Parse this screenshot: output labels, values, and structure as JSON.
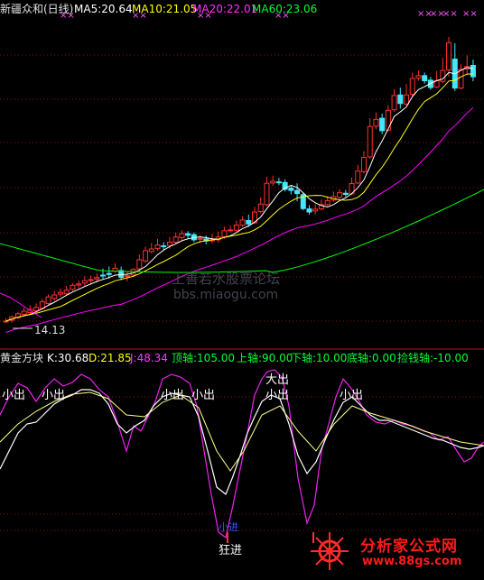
{
  "price_panel": {
    "name": "新疆众和(日线)",
    "ma5": "MA5:20.64",
    "ma10": "MA10:21.05",
    "ma20": "MA20:22.01",
    "ma60": "MA60:23.06",
    "low_marker": "14.13",
    "colors": {
      "ma5": "#ffffff",
      "ma10": "#ffff00",
      "ma20": "#ff00ff",
      "ma60": "#00ff00"
    }
  },
  "indicator_panel": {
    "name": "黄金方块",
    "k": "K:30.68",
    "d": "D:21.85",
    "j": "J:48.34",
    "top_axis": "顶轴:105.00",
    "upper_axis": "上轴:90.00",
    "lower_axis": "下轴:10.00",
    "bottom_axis": "底轴:0.00",
    "pickup_axis": "捡钱轴:-10.00"
  },
  "signals": {
    "small_out": "小出",
    "big_out": "大出",
    "crazy_in": "狂进",
    "small_in": "小进"
  },
  "watermark": {
    "line1": "上善若水股票论坛",
    "line2": "bbs.miaogu.com"
  },
  "logo": {
    "title": "分析家公式网",
    "url": "www.88gs.com"
  },
  "chart_data": {
    "type": "candlestick",
    "series": [
      {
        "name": "MA5",
        "values": [
          20.64
        ]
      },
      {
        "name": "MA10",
        "values": [
          21.05
        ]
      },
      {
        "name": "MA20",
        "values": [
          22.01
        ]
      },
      {
        "name": "MA60",
        "values": [
          23.06
        ]
      },
      {
        "name": "K",
        "values": [
          30.68
        ]
      },
      {
        "name": "D",
        "values": [
          21.85
        ]
      },
      {
        "name": "J",
        "values": [
          48.34
        ]
      }
    ],
    "axis_levels": {
      "top": 105,
      "upper": 90,
      "lower": 10,
      "bottom": 0,
      "pickup": -10
    },
    "low_price": 14.13,
    "candles_price_shape": [
      [
        0,
        0,
        0,
        1
      ],
      [
        0.3,
        1.5,
        -0.5,
        2
      ],
      [
        1.2,
        2.6,
        0.8,
        3.2
      ],
      [
        2.4,
        3.5,
        1.6,
        4.8
      ],
      [
        3,
        4.1,
        2.4,
        5.6
      ],
      [
        3.6,
        4.8,
        2.8,
        6.2
      ],
      [
        4.5,
        6.8,
        4,
        7.8
      ],
      [
        6.2,
        8.5,
        5.8,
        9.4
      ],
      [
        8,
        9.2,
        7.2,
        10.6
      ],
      [
        9.5,
        10.1,
        8.6,
        11.5
      ],
      [
        9.6,
        10.9,
        9.2,
        12.4
      ],
      [
        11.2,
        12.6,
        10.6,
        13.4
      ],
      [
        12.7,
        13.1,
        11.5,
        14.4
      ],
      [
        13.4,
        14.2,
        12.4,
        15.8
      ],
      [
        14.5,
        14.6,
        12.8,
        16
      ],
      [
        14.8,
        15.3,
        13.6,
        16.8
      ],
      [
        16.2,
        16.1,
        14.6,
        18.5
      ],
      [
        16.8,
        16.4,
        14.9,
        19.2
      ],
      [
        17.6,
        18.6,
        17,
        20.4
      ],
      [
        17.8,
        15.4,
        14.4,
        19.2
      ],
      [
        15.8,
        16,
        14,
        17.4
      ],
      [
        16.2,
        18.2,
        15.8,
        18.6
      ],
      [
        18.4,
        21.6,
        17.5,
        23.4
      ],
      [
        21.2,
        24.8,
        20.5,
        26.2
      ],
      [
        24.5,
        25.4,
        23.8,
        27.5
      ],
      [
        25.6,
        26.8,
        24.8,
        28.9
      ],
      [
        26.5,
        26.4,
        25,
        27.8
      ],
      [
        26.6,
        27.8,
        25.5,
        29.6
      ],
      [
        27.8,
        29.6,
        27.2,
        31.2
      ],
      [
        29.4,
        30.8,
        28.6,
        32
      ],
      [
        30.8,
        30.2,
        28.8,
        31.7
      ],
      [
        30.4,
        28.6,
        27.8,
        31.2
      ],
      [
        28.8,
        29.1,
        27.5,
        30.2
      ],
      [
        28.9,
        28.2,
        27,
        30.1
      ],
      [
        28.4,
        28.6,
        27.4,
        30.8
      ],
      [
        28.6,
        29.6,
        27.6,
        31.5
      ],
      [
        29.7,
        31.8,
        29,
        33.2
      ],
      [
        31.9,
        32.1,
        31.2,
        33.5
      ],
      [
        32,
        33.8,
        31.5,
        35.4
      ],
      [
        33.8,
        35.6,
        33.2,
        36.8
      ],
      [
        35.4,
        34.2,
        33.2,
        37.5
      ],
      [
        34.6,
        38.4,
        34.2,
        40.2
      ],
      [
        38.6,
        41.2,
        38,
        43.6
      ],
      [
        41,
        48.5,
        40.4,
        50.8
      ],
      [
        48.6,
        49.2,
        47.6,
        51.2
      ],
      [
        49,
        48.8,
        47.8,
        50.4
      ],
      [
        48.8,
        46.4,
        45.6,
        49.9
      ],
      [
        46.8,
        46,
        44.6,
        47.6
      ],
      [
        46,
        44.9,
        42.2,
        48.5
      ],
      [
        44.5,
        39.6,
        39,
        45.2
      ],
      [
        39.5,
        38.4,
        37.5,
        40.8
      ],
      [
        38.8,
        39.4,
        37.6,
        41.2
      ],
      [
        39.5,
        41,
        39,
        42.8
      ],
      [
        41,
        42.4,
        40.6,
        44
      ],
      [
        42.6,
        43.8,
        42,
        45.6
      ],
      [
        43.6,
        45.2,
        43,
        46.4
      ],
      [
        45,
        44.6,
        43.8,
        46.2
      ],
      [
        44.8,
        48.4,
        44.4,
        50.5
      ],
      [
        48.6,
        52.8,
        48.2,
        55
      ],
      [
        52.6,
        57.6,
        52,
        59.8
      ],
      [
        57.8,
        68.5,
        57.2,
        71.4
      ],
      [
        68.6,
        71,
        67.6,
        73.5
      ],
      [
        71.4,
        67,
        65.8,
        73
      ],
      [
        67.2,
        74.2,
        66.8,
        76
      ],
      [
        74.4,
        79.4,
        73.6,
        81.6
      ],
      [
        79.6,
        76.6,
        74.8,
        82.2
      ],
      [
        76.4,
        79.6,
        76,
        83.4
      ],
      [
        79.8,
        85.4,
        79,
        87.4
      ],
      [
        85.6,
        86.4,
        84.6,
        88.2
      ],
      [
        86.4,
        84.6,
        83.6,
        87.5
      ],
      [
        84.8,
        82.2,
        81.4,
        86
      ],
      [
        82.4,
        84.6,
        82,
        88
      ],
      [
        84.4,
        88.2,
        83.8,
        92.6
      ],
      [
        88.4,
        98,
        86,
        100
      ],
      [
        92.2,
        82,
        81,
        97.8
      ],
      [
        82,
        88.6,
        81.6,
        90.4
      ],
      [
        88.8,
        89.6,
        86.6,
        93.5
      ],
      [
        90,
        86,
        84.4,
        92
      ]
    ]
  }
}
